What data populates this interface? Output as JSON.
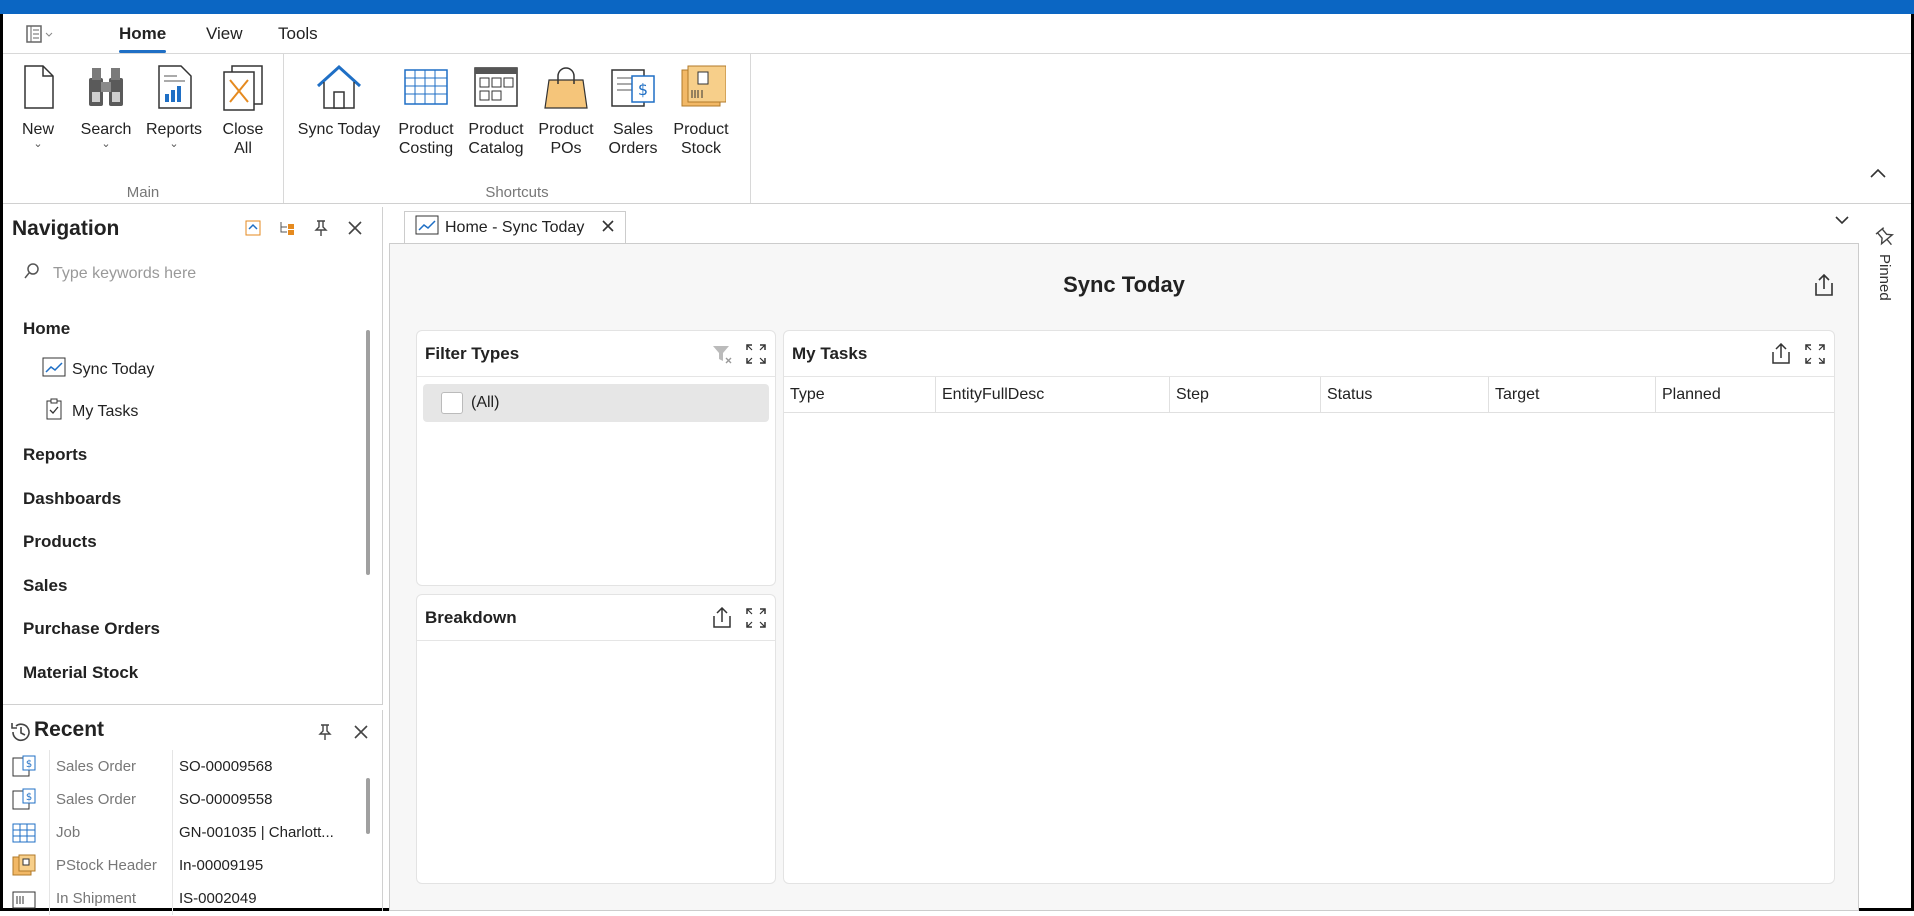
{
  "menu": {
    "app_icon": "app-menu-icon",
    "tabs": [
      {
        "label": "Home",
        "active": true
      },
      {
        "label": "View",
        "active": false
      },
      {
        "label": "Tools",
        "active": false
      }
    ]
  },
  "ribbon": {
    "groups": [
      {
        "caption": "Main",
        "buttons": [
          {
            "line1": "New",
            "line2": "",
            "icon": "new-document-icon",
            "dropdown": true
          },
          {
            "line1": "Search",
            "line2": "",
            "icon": "binoculars-icon",
            "dropdown": true
          },
          {
            "line1": "Reports",
            "line2": "",
            "icon": "report-icon",
            "dropdown": true
          },
          {
            "line1": "Close",
            "line2": "All",
            "icon": "close-all-icon",
            "dropdown": false
          }
        ]
      },
      {
        "caption": "Shortcuts",
        "buttons": [
          {
            "line1": "Sync Today",
            "line2": "",
            "icon": "home-icon"
          },
          {
            "line1": "Product",
            "line2": "Costing",
            "icon": "grid-icon"
          },
          {
            "line1": "Product",
            "line2": "Catalog",
            "icon": "catalog-icon"
          },
          {
            "line1": "Product",
            "line2": "POs",
            "icon": "shopping-bag-icon"
          },
          {
            "line1": "Sales",
            "line2": "Orders",
            "icon": "sales-order-icon"
          },
          {
            "line1": "Product",
            "line2": "Stock",
            "icon": "stock-box-icon"
          }
        ]
      }
    ]
  },
  "navigation": {
    "title": "Navigation",
    "search_placeholder": "Type keywords here",
    "items": [
      {
        "label": "Home"
      },
      {
        "label": "Sync Today"
      },
      {
        "label": "My Tasks"
      },
      {
        "label": "Reports"
      },
      {
        "label": "Dashboards"
      },
      {
        "label": "Products"
      },
      {
        "label": "Sales"
      },
      {
        "label": "Purchase Orders"
      },
      {
        "label": "Material Stock"
      }
    ]
  },
  "recent": {
    "title": "Recent",
    "rows": [
      {
        "type": "Sales Order",
        "value": "SO-00009568",
        "icon": "sales-order-icon"
      },
      {
        "type": "Sales Order",
        "value": "SO-00009558",
        "icon": "sales-order-icon"
      },
      {
        "type": "Job",
        "value": "GN-001035 | Charlott...",
        "icon": "job-grid-icon"
      },
      {
        "type": "PStock Header",
        "value": "In-00009195",
        "icon": "stock-header-icon"
      },
      {
        "type": "In Shipment",
        "value": "IS-0002049",
        "icon": "shipment-icon"
      }
    ]
  },
  "document": {
    "tab_label": "Home - Sync Today",
    "page_title": "Sync Today",
    "pinned_label": "Pinned"
  },
  "filter_panel": {
    "title": "Filter Types",
    "items": [
      {
        "label": "(All)",
        "checked": false
      }
    ]
  },
  "breakdown_panel": {
    "title": "Breakdown"
  },
  "tasks_panel": {
    "title": "My Tasks",
    "columns": [
      "Type",
      "EntityFullDesc",
      "Step",
      "Status",
      "Target",
      "Planned"
    ],
    "rows": []
  },
  "colors": {
    "accent": "#0b66c3",
    "tab_underline": "#1f6fc5"
  }
}
